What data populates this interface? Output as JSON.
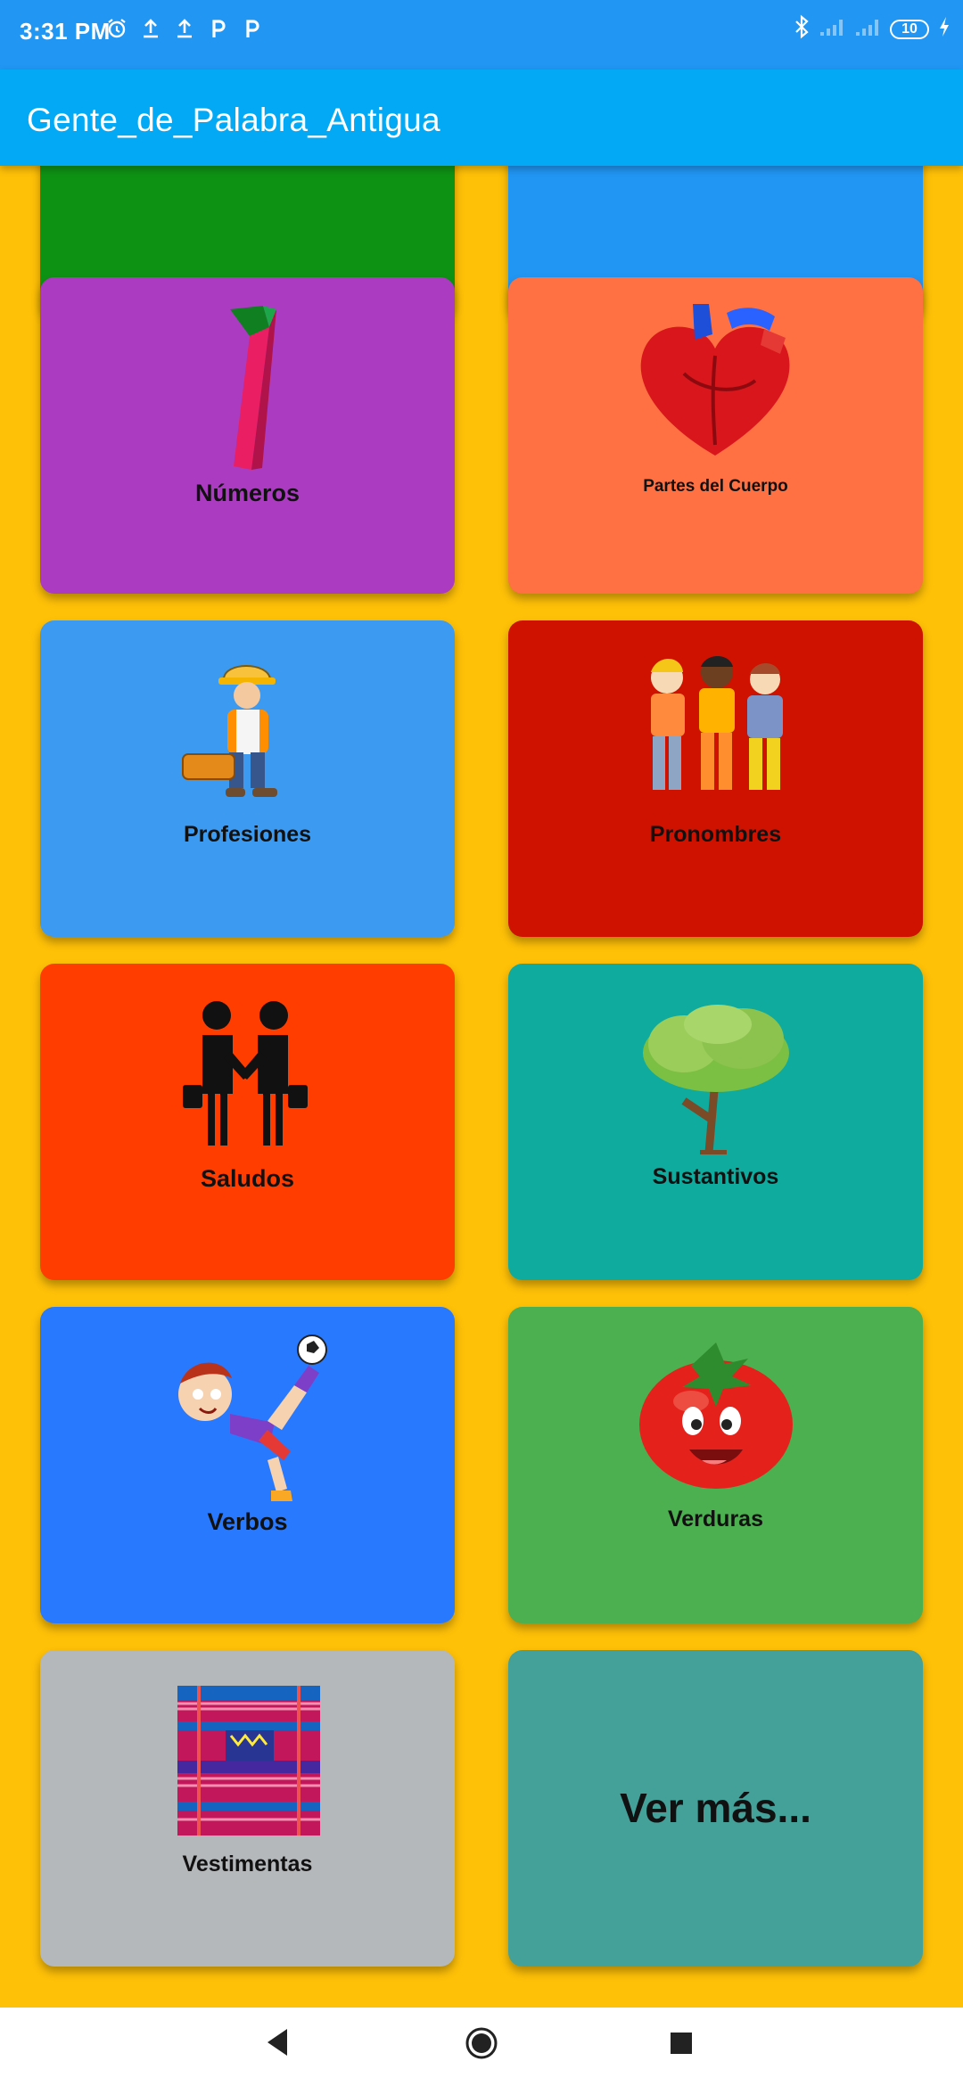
{
  "status_bar": {
    "time": "3:31 PM",
    "battery": "10",
    "left_icons": [
      "alarm-icon",
      "upload-icon",
      "upload-icon",
      "p-app-icon",
      "p-app-icon"
    ],
    "right_icons": [
      "bluetooth-icon",
      "signal-icon",
      "signal-icon",
      "battery-icon",
      "charging-icon"
    ]
  },
  "app_bar": {
    "title": "Gente_de_Palabra_Antigua"
  },
  "categories": [
    {
      "label": "Números",
      "color": "#AB3CC1",
      "icon": "number-one-icon"
    },
    {
      "label": "Partes del Cuerpo",
      "color": "#FF7043",
      "icon": "heart-icon"
    },
    {
      "label": "Profesiones",
      "color": "#3C9BF1",
      "icon": "worker-icon"
    },
    {
      "label": "Pronombres",
      "color": "#CF1200",
      "icon": "kids-icon"
    },
    {
      "label": "Saludos",
      "color": "#FF3D00",
      "icon": "handshake-icon"
    },
    {
      "label": "Sustantivos",
      "color": "#0FAB9E",
      "icon": "tree-icon"
    },
    {
      "label": "Verbos",
      "color": "#2979FF",
      "icon": "kicking-boy-icon"
    },
    {
      "label": "Verduras",
      "color": "#4CAF50",
      "icon": "tomato-icon"
    },
    {
      "label": "Vestimentas",
      "color": "#B5B8BA",
      "icon": "textile-icon"
    }
  ],
  "more_button": {
    "label": "Ver más...",
    "color": "#43A19A"
  },
  "top_partial_cards": [
    {
      "color": "#0E9214"
    },
    {
      "color": "#2196F3"
    }
  ],
  "nav_bar": {
    "icons": [
      "back-icon",
      "home-icon",
      "recents-icon"
    ]
  }
}
